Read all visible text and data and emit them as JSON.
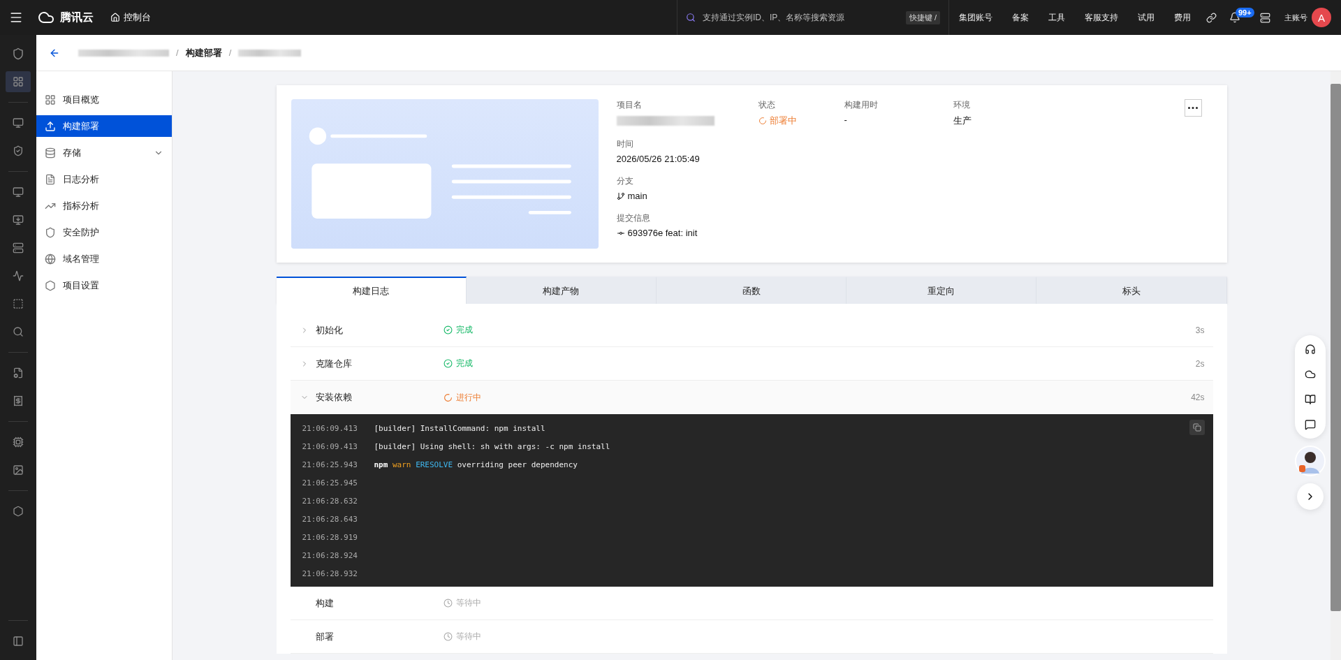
{
  "topbar": {
    "logo": "腾讯云",
    "console": "控制台",
    "search_placeholder": "支持通过实例ID、IP、名称等搜索资源",
    "shortcut": "快捷键 /",
    "links": [
      "集团账号",
      "备案",
      "工具",
      "客服支持",
      "试用",
      "费用"
    ],
    "notification_badge": "99+",
    "account": "主账号",
    "avatar": "A"
  },
  "breadcrumb": [
    {
      "kind": "redacted"
    },
    {
      "kind": "separator",
      "text": "/"
    },
    {
      "kind": "current",
      "text": "构建部署"
    },
    {
      "kind": "separator",
      "text": "/"
    },
    {
      "kind": "redacted"
    }
  ],
  "sidebar": {
    "items": [
      {
        "label": "项目概览",
        "kind": "link",
        "selected": false
      },
      {
        "label": "构建部署",
        "kind": "link",
        "selected": true
      },
      {
        "label": "存储",
        "kind": "group",
        "selected": false
      },
      {
        "label": "日志分析",
        "kind": "link",
        "selected": false
      },
      {
        "label": "指标分析",
        "kind": "link",
        "selected": false
      },
      {
        "label": "安全防护",
        "kind": "link",
        "selected": false
      },
      {
        "label": "域名管理",
        "kind": "link",
        "selected": false
      },
      {
        "label": "项目设置",
        "kind": "link",
        "selected": false
      }
    ]
  },
  "project": {
    "summary": [
      {
        "label": "项目名",
        "kind": "redacted"
      },
      {
        "label": "状态",
        "kind": "status",
        "value": "部署中"
      },
      {
        "label": "构建用时",
        "kind": "text",
        "value": "-"
      },
      {
        "label": "环境",
        "kind": "text",
        "value": "生产"
      }
    ],
    "details": [
      {
        "label": "时间",
        "kind": "text",
        "value": "2026/05/26 21:05:49"
      },
      {
        "label": "分支",
        "kind": "branch",
        "value": "main"
      },
      {
        "label": "提交信息",
        "kind": "commit",
        "value": "693976e feat: init"
      }
    ]
  },
  "tabs": [
    {
      "label": "构建日志",
      "selected": true
    },
    {
      "label": "构建产物",
      "selected": false
    },
    {
      "label": "函数",
      "selected": false
    },
    {
      "label": "重定向",
      "selected": false
    },
    {
      "label": "标头",
      "selected": false
    }
  ],
  "steps": [
    {
      "name": "初始化",
      "kind": "done",
      "status_text": "完成",
      "duration": "3s",
      "expanded": false
    },
    {
      "name": "克隆仓库",
      "kind": "done",
      "status_text": "完成",
      "duration": "2s",
      "expanded": false
    },
    {
      "name": "安装依赖",
      "kind": "running",
      "status_text": "进行中",
      "duration": "42s",
      "expanded": true,
      "log": [
        {
          "time": "21:06:09.413",
          "segments": [
            {
              "kind": "plain",
              "text": "[builder] InstallCommand: npm install"
            }
          ]
        },
        {
          "time": "21:06:09.413",
          "segments": [
            {
              "kind": "plain",
              "text": "[builder] Using shell: sh with args: -c npm install"
            }
          ]
        },
        {
          "time": "21:06:25.943",
          "segments": [
            {
              "kind": "bold",
              "text": "npm"
            },
            {
              "kind": "warn",
              "text": "warn"
            },
            {
              "kind": "code",
              "text": "ERESOLVE"
            },
            {
              "kind": "plain",
              "text": "overriding peer dependency"
            }
          ]
        },
        {
          "time": "21:06:25.945"
        },
        {
          "time": "21:06:28.632"
        },
        {
          "time": "21:06:28.643"
        },
        {
          "time": "21:06:28.919"
        },
        {
          "time": "21:06:28.924"
        },
        {
          "time": "21:06:28.932"
        }
      ]
    },
    {
      "name": "构建",
      "kind": "waiting",
      "status_text": "等待中",
      "expanded": false
    },
    {
      "name": "部署",
      "kind": "waiting",
      "status_text": "等待中",
      "expanded": false
    }
  ]
}
